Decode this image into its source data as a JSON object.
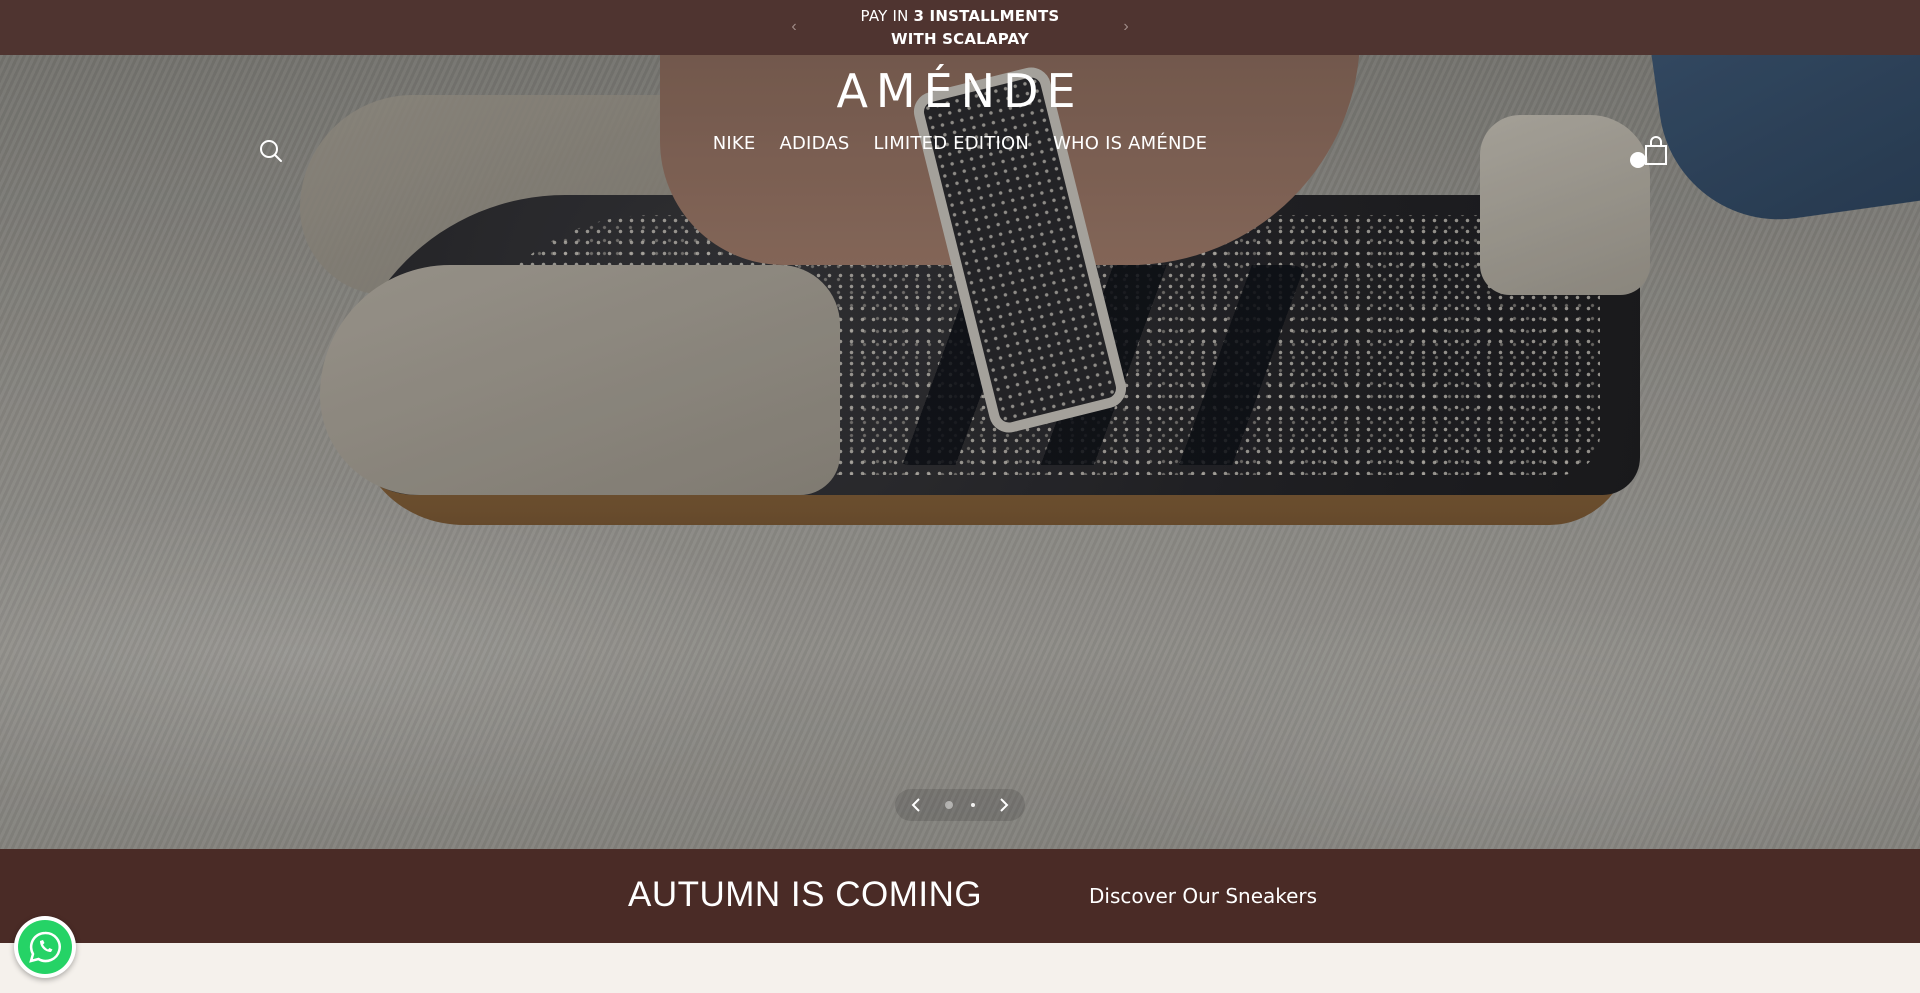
{
  "announcement": {
    "line1_prefix": "PAY IN ",
    "line1_bold": "3 INSTALLMENTS",
    "line2": "WITH SCALAPAY",
    "prev_icon": "chevron-left-icon",
    "next_icon": "chevron-right-icon"
  },
  "header": {
    "logo": "AMÉNDE",
    "nav": [
      "NIKE",
      "ADIDAS",
      "LIMITED EDITION",
      "WHO IS AMÉNDE"
    ],
    "search_icon": "search-icon",
    "cart_icon": "shopping-bag-icon"
  },
  "slider": {
    "slides": 2,
    "active": 1
  },
  "promo": {
    "title": "AUTUMN IS COMING",
    "link": "Discover Our Sneakers"
  },
  "colors": {
    "announcement_bg": "#4f3430",
    "promo_bg": "#4a2b26",
    "whatsapp": "#25d366",
    "page_bg": "#f5f1ec"
  }
}
